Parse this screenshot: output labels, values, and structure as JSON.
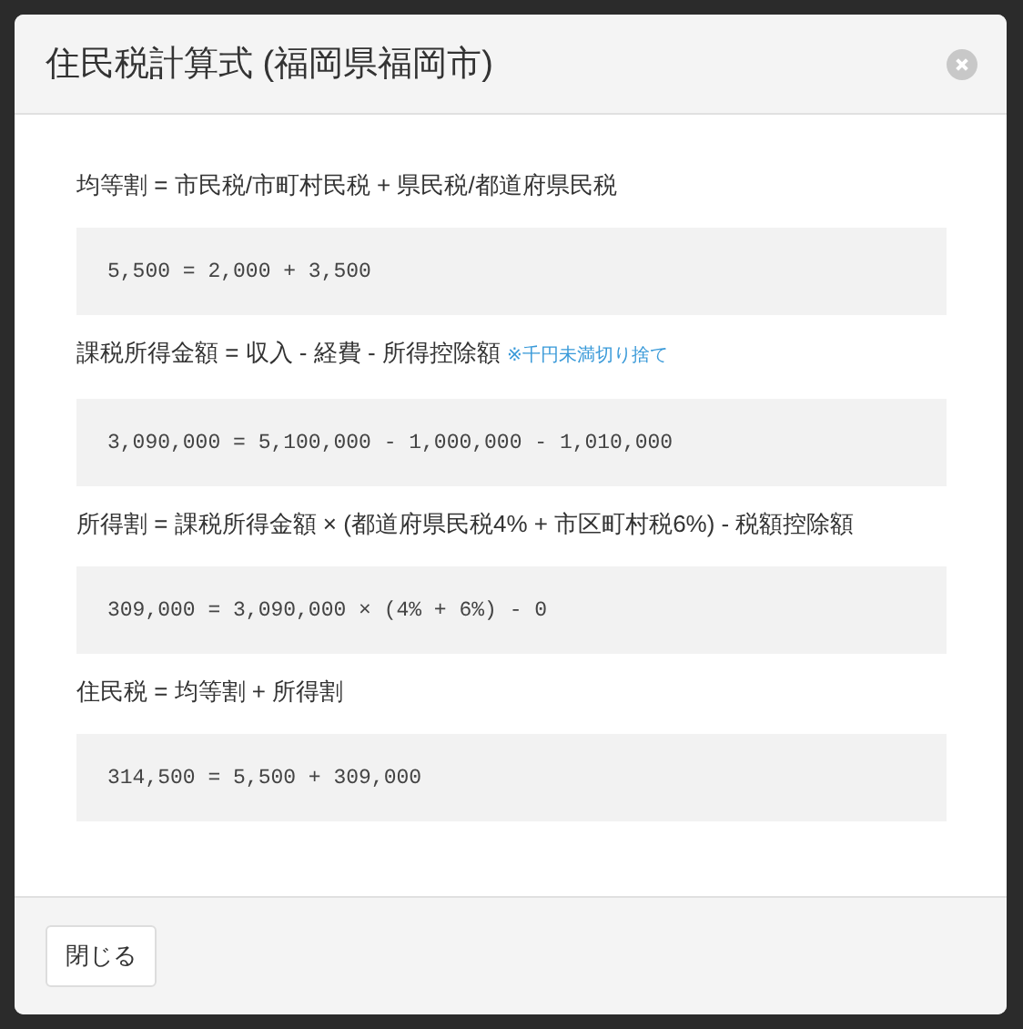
{
  "dialog": {
    "title": "住民税計算式 (福岡県福岡市)",
    "formulas": [
      {
        "formula": "均等割 = 市民税/市町村民税 + 県民税/都道府県民税",
        "calculation": "5,500 = 2,000 + 3,500"
      },
      {
        "formula": "課税所得金額 = 収入 - 経費 - 所得控除額",
        "note": "※千円未満切り捨て",
        "calculation": "3,090,000 = 5,100,000 - 1,000,000 - 1,010,000"
      },
      {
        "formula": "所得割 = 課税所得金額 × (都道府県民税4% + 市区町村税6%) - 税額控除額",
        "calculation": "309,000 = 3,090,000 × (4% + 6%) - 0"
      },
      {
        "formula": "住民税 = 均等割 + 所得割",
        "calculation": "314,500 = 5,500 + 309,000"
      }
    ],
    "close_button": "閉じる"
  }
}
